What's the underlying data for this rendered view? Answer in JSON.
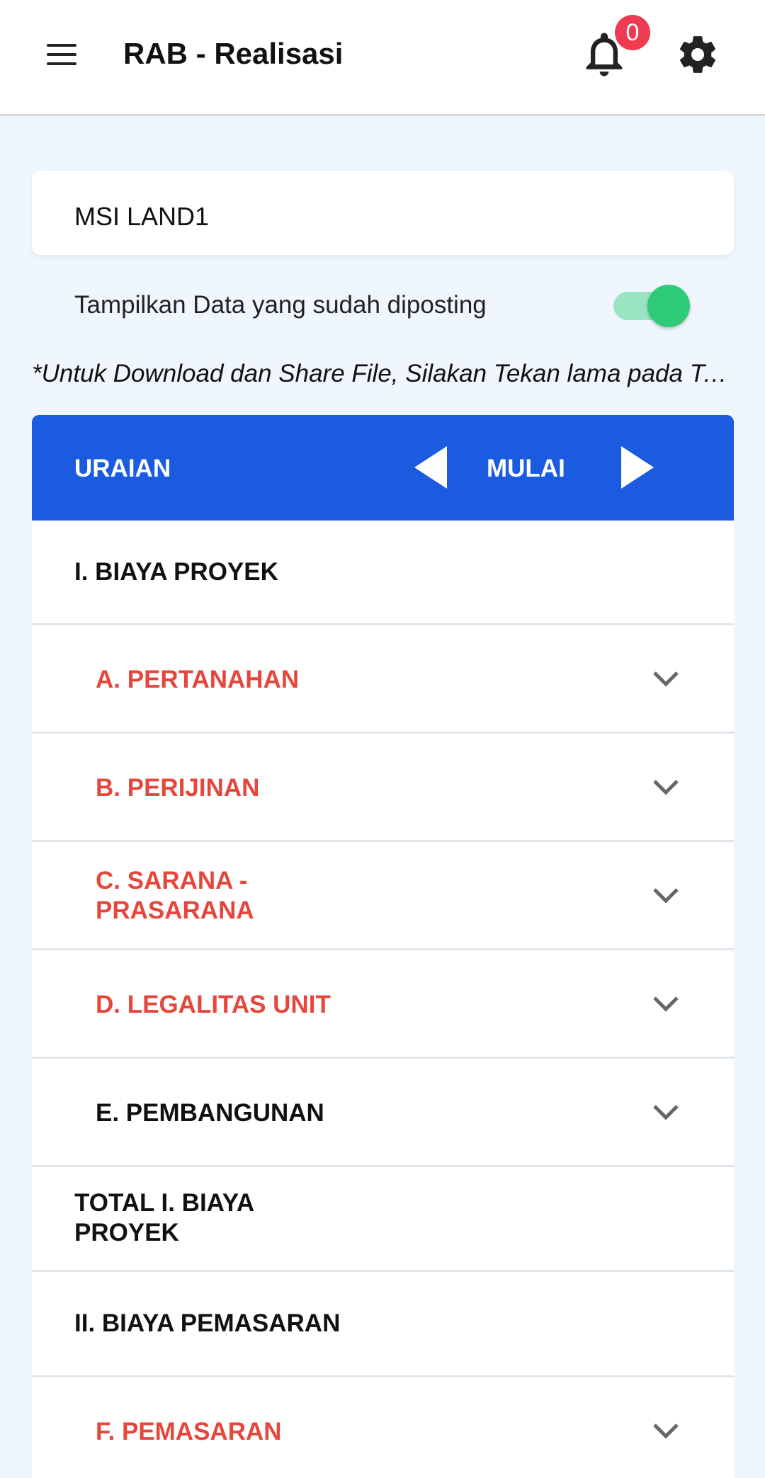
{
  "header": {
    "title": "RAB - Realisasi",
    "notification_count": "0",
    "icons": {
      "menu": "menu-icon",
      "bell": "bell-icon",
      "settings": "gear-icon"
    }
  },
  "project_select": {
    "value": "MSI LAND1"
  },
  "posted_toggle": {
    "label": "Tampilkan Data yang sudah diposting",
    "on": true
  },
  "hint_text": "*Untuk Download dan Share File, Silakan Tekan lama pada Tabel",
  "table": {
    "header": {
      "label": "URAIAN",
      "column": "MULAI"
    },
    "rows": [
      {
        "text": "I. BIAYA PROYEK",
        "level": "section"
      },
      {
        "text": "A. PERTANAHAN",
        "level": "sub",
        "color": "#e5473c"
      },
      {
        "text": "B. PERIJINAN",
        "level": "sub",
        "color": "#e5473c"
      },
      {
        "text_line1": "C. SARANA -",
        "text_line2": "PRASARANA",
        "level": "sub",
        "color": "#e5473c"
      },
      {
        "text": "D. LEGALITAS UNIT",
        "level": "sub",
        "color": "#e5473c"
      },
      {
        "text": "E. PEMBANGUNAN",
        "level": "sub",
        "color": "#111111"
      },
      {
        "text_line1": "TOTAL I. BIAYA",
        "text_line2": "PROYEK",
        "level": "total"
      },
      {
        "text": "II. BIAYA PEMASARAN",
        "level": "section"
      },
      {
        "text": "F. PEMASARAN",
        "level": "sub",
        "color": "#e5473c"
      }
    ]
  },
  "colors": {
    "accent": "#1b5be0",
    "badge": "#ef3b52",
    "toggle_on": "#2ecc78",
    "subcategory": "#e5473c",
    "background": "#eff6fd"
  }
}
